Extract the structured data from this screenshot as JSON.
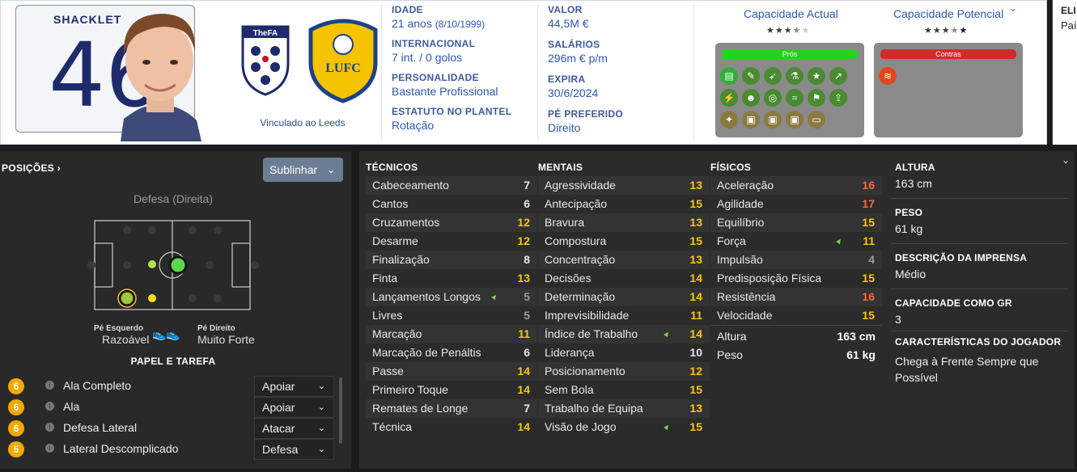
{
  "header": {
    "shirt_name": "SHACKLET",
    "shirt_number": "46",
    "linked_text": "Vinculado ao Leeds",
    "fa_crest_text": "TheFA",
    "leeds_crest_text": "LUFC",
    "info_col1": [
      {
        "label": "IDADE",
        "value": "21 anos",
        "extra": "(8/10/1999)"
      },
      {
        "label": "INTERNACIONAL",
        "value": "7 int. / 0 golos"
      },
      {
        "label": "PERSONALIDADE",
        "value": "Bastante Profissional"
      },
      {
        "label": "ESTATUTO NO PLANTEL",
        "value": "Rotação"
      }
    ],
    "info_col2": [
      {
        "label": "VALOR",
        "value": "44,5M €"
      },
      {
        "label": "SALÁRIOS",
        "value": "296m € p/m"
      },
      {
        "label": "EXPIRA",
        "value": "30/6/2024"
      },
      {
        "label": "PÉ PREFERIDO",
        "value": "Direito"
      }
    ],
    "current_ability_label": "Capacidade Actual",
    "potential_ability_label": "Capacidade Potencial",
    "current_stars": 3.5,
    "potential_stars": 3.5,
    "pros_label": "Prós",
    "cons_label": "Contras",
    "right_clip_label": "ELI",
    "right_clip_value": "País"
  },
  "positions": {
    "title": "POSIÇÕES ›",
    "highlight_dropdown": "Sublinhar",
    "current_position": "Defesa (Direita)",
    "left_foot_label": "Pé Esquerdo",
    "left_foot_value": "Razoável",
    "right_foot_label": "Pé Direito",
    "right_foot_value": "Muito Forte",
    "role_duty_title": "PAPEL E TAREFA",
    "roles": [
      {
        "rating": "6",
        "name": "Ala Completo",
        "duty": "Apoiar"
      },
      {
        "rating": "6",
        "name": "Ala",
        "duty": "Apoiar"
      },
      {
        "rating": "6",
        "name": "Defesa Lateral",
        "duty": "Atacar"
      },
      {
        "rating": "5",
        "name": "Lateral Descomplicado",
        "duty": "Defesa"
      }
    ]
  },
  "attributes": {
    "technical_title": "TÉCNICOS",
    "mental_title": "MENTAIS",
    "physical_title": "FÍSICOS",
    "technical": [
      {
        "name": "Cabeceamento",
        "value": "7",
        "color": "#e6e6e6"
      },
      {
        "name": "Cantos",
        "value": "6",
        "color": "#e6e6e6"
      },
      {
        "name": "Cruzamentos",
        "value": "12",
        "color": "#f5c518"
      },
      {
        "name": "Desarme",
        "value": "12",
        "color": "#f5c518"
      },
      {
        "name": "Finalização",
        "value": "8",
        "color": "#e6e6e6"
      },
      {
        "name": "Finta",
        "value": "13",
        "color": "#f5c518"
      },
      {
        "name": "Lançamentos Longos",
        "value": "5",
        "color": "#9a9a9a",
        "trend": true
      },
      {
        "name": "Livres",
        "value": "5",
        "color": "#9a9a9a"
      },
      {
        "name": "Marcação",
        "value": "11",
        "color": "#f5c518"
      },
      {
        "name": "Marcação de Penáltis",
        "value": "6",
        "color": "#e6e6e6"
      },
      {
        "name": "Passe",
        "value": "14",
        "color": "#f5c518"
      },
      {
        "name": "Primeiro Toque",
        "value": "14",
        "color": "#f5c518"
      },
      {
        "name": "Remates de Longe",
        "value": "7",
        "color": "#e6e6e6"
      },
      {
        "name": "Técnica",
        "value": "14",
        "color": "#f5c518"
      }
    ],
    "mental": [
      {
        "name": "Agressividade",
        "value": "13",
        "color": "#f5c518"
      },
      {
        "name": "Antecipação",
        "value": "15",
        "color": "#f5c518"
      },
      {
        "name": "Bravura",
        "value": "13",
        "color": "#f5c518"
      },
      {
        "name": "Compostura",
        "value": "15",
        "color": "#f5c518"
      },
      {
        "name": "Concentração",
        "value": "13",
        "color": "#f5c518"
      },
      {
        "name": "Decisões",
        "value": "14",
        "color": "#f5c518"
      },
      {
        "name": "Determinação",
        "value": "14",
        "color": "#f5c518"
      },
      {
        "name": "Imprevisibilidade",
        "value": "11",
        "color": "#f5c518"
      },
      {
        "name": "Índice de Trabalho",
        "value": "14",
        "color": "#f5c518",
        "trend": true
      },
      {
        "name": "Liderança",
        "value": "10",
        "color": "#e6e6e6"
      },
      {
        "name": "Posicionamento",
        "value": "12",
        "color": "#f5c518"
      },
      {
        "name": "Sem Bola",
        "value": "15",
        "color": "#f5c518"
      },
      {
        "name": "Trabalho de Equipa",
        "value": "13",
        "color": "#f5c518"
      },
      {
        "name": "Visão de Jogo",
        "value": "15",
        "color": "#f5c518",
        "trend": true
      }
    ],
    "physical": [
      {
        "name": "Aceleração",
        "value": "16",
        "color": "#f26a3a"
      },
      {
        "name": "Agilidade",
        "value": "17",
        "color": "#f26a3a"
      },
      {
        "name": "Equilíbrio",
        "value": "15",
        "color": "#f5c518"
      },
      {
        "name": "Força",
        "value": "11",
        "color": "#f5c518",
        "trend": true
      },
      {
        "name": "Impulsão",
        "value": "4",
        "color": "#9a9a9a"
      },
      {
        "name": "Predisposição Física",
        "value": "15",
        "color": "#f5c518"
      },
      {
        "name": "Resistência",
        "value": "16",
        "color": "#f26a3a"
      },
      {
        "name": "Velocidade",
        "value": "15",
        "color": "#f5c518"
      }
    ],
    "height_label": "Altura",
    "height_value": "163 cm",
    "weight_label": "Peso",
    "weight_value": "61 kg"
  },
  "side_info": [
    {
      "label": "ALTURA",
      "value": "163 cm"
    },
    {
      "label": "PESO",
      "value": "61 kg"
    },
    {
      "label": "DESCRIÇÃO DA IMPRENSA",
      "value": "Médio"
    },
    {
      "label": "CAPACIDADE COMO GR",
      "value": "3"
    },
    {
      "label": "CARACTERÍSTICAS DO JOGADOR",
      "value": "Chega à Frente Sempre que Possível"
    }
  ]
}
